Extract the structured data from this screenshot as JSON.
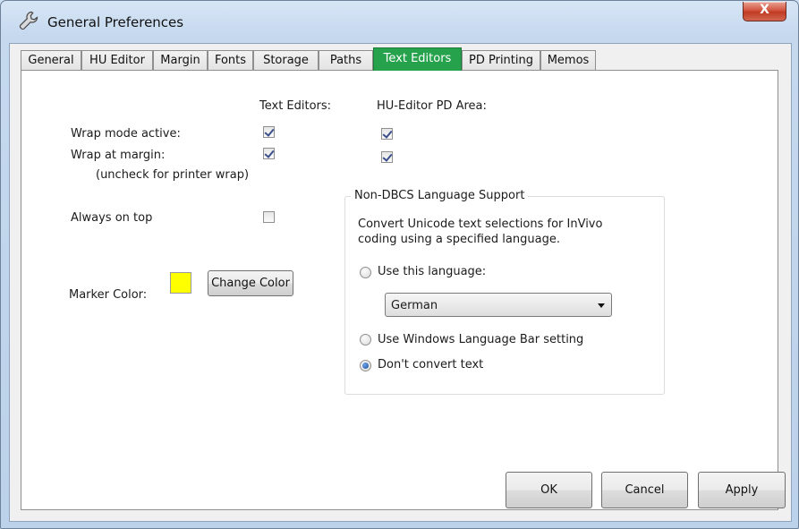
{
  "window": {
    "title": "General Preferences",
    "close_label": "X",
    "icon": "wrench-icon"
  },
  "tabs": [
    {
      "label": "General",
      "active": false
    },
    {
      "label": "HU Editor",
      "active": false
    },
    {
      "label": "Margin",
      "active": false
    },
    {
      "label": "Fonts",
      "active": false
    },
    {
      "label": "Storage",
      "active": false
    },
    {
      "label": "Paths",
      "active": false
    },
    {
      "label": "Text Editors",
      "active": true
    },
    {
      "label": "PD Printing",
      "active": false
    },
    {
      "label": "Memos",
      "active": false
    }
  ],
  "accent_color": "#26a24c",
  "text_editors": {
    "col_text_editors": "Text Editors:",
    "col_hu_editor": "HU-Editor PD Area:",
    "wrap_mode_label": "Wrap mode active:",
    "wrap_margin_label": "Wrap at margin:",
    "wrap_margin_hint": "(uncheck for printer wrap)",
    "always_on_top_label": "Always on top",
    "wrap_mode_text_editors": true,
    "wrap_mode_hu_editor": true,
    "wrap_margin_text_editors": true,
    "wrap_margin_hu_editor": true,
    "always_on_top": false
  },
  "marker": {
    "label": "Marker Color:",
    "color": "#ffff00",
    "change_button": "Change Color"
  },
  "language": {
    "group_title": "Non-DBCS Language Support",
    "description_line1": "Convert Unicode text selections for InVivo",
    "description_line2": "coding using a specified language.",
    "use_language_label": "Use this language:",
    "selected_language": "German",
    "use_windows_label": "Use Windows Language Bar setting",
    "dont_convert_label": "Don't convert text",
    "selected_option": "dont_convert"
  },
  "buttons": {
    "ok": "OK",
    "cancel": "Cancel",
    "apply": "Apply"
  }
}
